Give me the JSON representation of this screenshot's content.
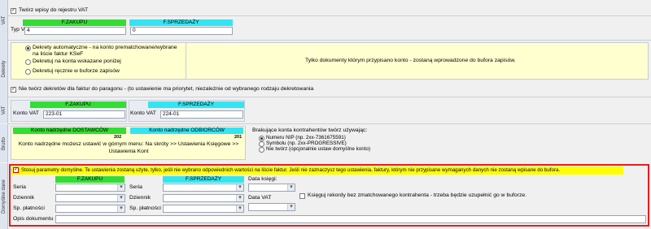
{
  "vat": {
    "side_label": "VAT",
    "register_checkbox_label": "Twórz wpisy do rejestru VAT",
    "register_checked": true,
    "zakupu_header": "F.ZAKUPU",
    "sprzedazy_header": "F.SPRZEDAŻY",
    "typ_vat_label": "Typ VAT",
    "typ_vat_zakupu": "4",
    "typ_vat_sprzedazy": "0"
  },
  "dekrety": {
    "side_label": "Dekrety",
    "option_auto": "Dekrety automatyczne - na konto prematchowane/wybrane na liście faktur KSeF",
    "option_wskazane": "Dekretuj na konta wskazane poniżej",
    "option_reczne": "Dekretuj ręcznie w buforze zapisów",
    "info_text": "Tylko dokumenty którym przypisano konto - zostaną wprowadzone do bufora zapisów.",
    "paragon_checkbox_label": "Nie twórz dekretów dla faktur do paragonu - (to ustawienie ma priorytet, niezależnie od wybranego rodzaju dekretowania",
    "paragon_checked": true
  },
  "vat2": {
    "side_label": "VAT",
    "zakupu_header": "F.ZAKUPU",
    "sprzedazy_header": "F.SPRZEDAŻY",
    "konto_vat_label": "Konto VAT",
    "konto_vat_zakupu": "223-01",
    "konto_vat_sprzedazy": "224-01"
  },
  "brutto": {
    "side_label": "Brutto",
    "dostawcow_header": "Konto nadrzędne DOSTAWCÓW",
    "dostawcow_value": "202",
    "odbiorcow_header": "Konto nadrzędne ODBIORCÓW",
    "odbiorcow_value": "201",
    "note": "Konto nadrzędne możesz ustawić w górnym menu: Na skróty >> Ustawienia Księgowe >> Ustawienia Kont",
    "missing_title": "Brakujące konta kontrahentów twórz używając:",
    "missing_nip": "Numeru NIP (np. 2xx-7361675591)",
    "missing_symbol": "Symbolu (np. 2xx-PROGRESSIVE)",
    "missing_none": "Nie twórz (opcjonalnie ustaw domyślne konto)"
  },
  "domyslne": {
    "side_label": "Domyślne dane",
    "checkbox_label": "Stosuj parametry domyślne. Te ustawienia zostaną użyte, tylko, jeśli nie wybrano odpowiednich wartości na liście faktur. Jeśli nie zaznaczysz tego ustawienia, faktury, którym nie przypisane wymaganych danych nie zostaną wpisane do bufora.",
    "checked": true,
    "zakupu_header": "F.ZAKUPU",
    "sprzedazy_header": "F.SPRZEDAŻY",
    "seria_label": "Seria",
    "dziennik_label": "Dziennik",
    "platnosci_label": "Sp. płatności",
    "data_ksiegi_label": "Data księgi:",
    "data_vat_label": "Data VAT",
    "bez_kontrahenta_label": "Księguj rekordy bez zmatchowanego kontrahenta - trzeba będzie uzupełnić go w buforze.",
    "opis_label": "Opis dokumentu"
  },
  "colors": {
    "green_header": "#33dd33",
    "cyan_header": "#33e5f0",
    "highlight_yellow": "#ffff00",
    "frame_red": "#e02020"
  }
}
